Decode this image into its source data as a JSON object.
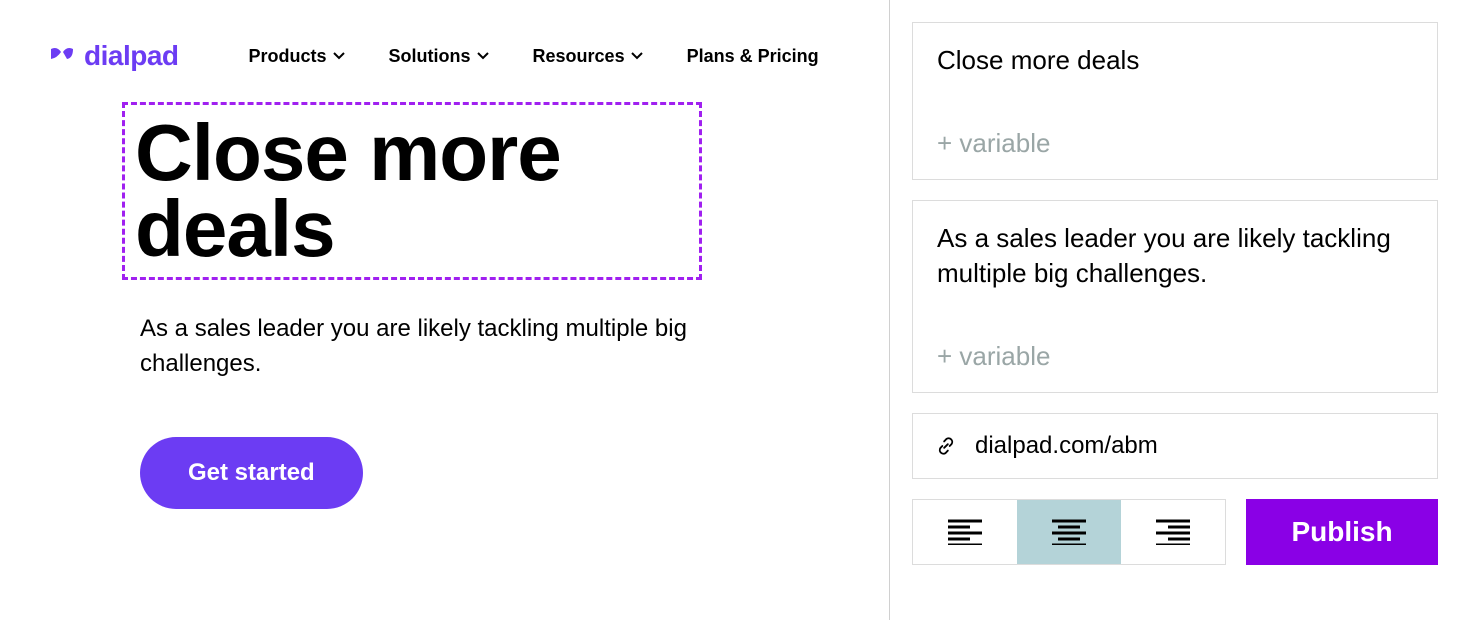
{
  "brand": {
    "name": "dialpad"
  },
  "nav": {
    "products": "Products",
    "solutions": "Solutions",
    "resources": "Resources",
    "plans": "Plans & Pricing"
  },
  "hero": {
    "title": "Close more deals",
    "subtitle": "As a sales leader you are likely tackling multiple big challenges.",
    "cta": "Get started"
  },
  "editor": {
    "title_value": "Close more deals",
    "body_value": "As a sales leader you are likely tackling multiple big challenges.",
    "add_variable_label": "+ variable",
    "url": "dialpad.com/abm",
    "publish_label": "Publish",
    "align_selected": "center"
  },
  "colors": {
    "brand_purple": "#6c3cf3",
    "publish_purple": "#8a00e6",
    "selection_dash": "#a020f0",
    "active_align_bg": "#b4d3d8"
  }
}
